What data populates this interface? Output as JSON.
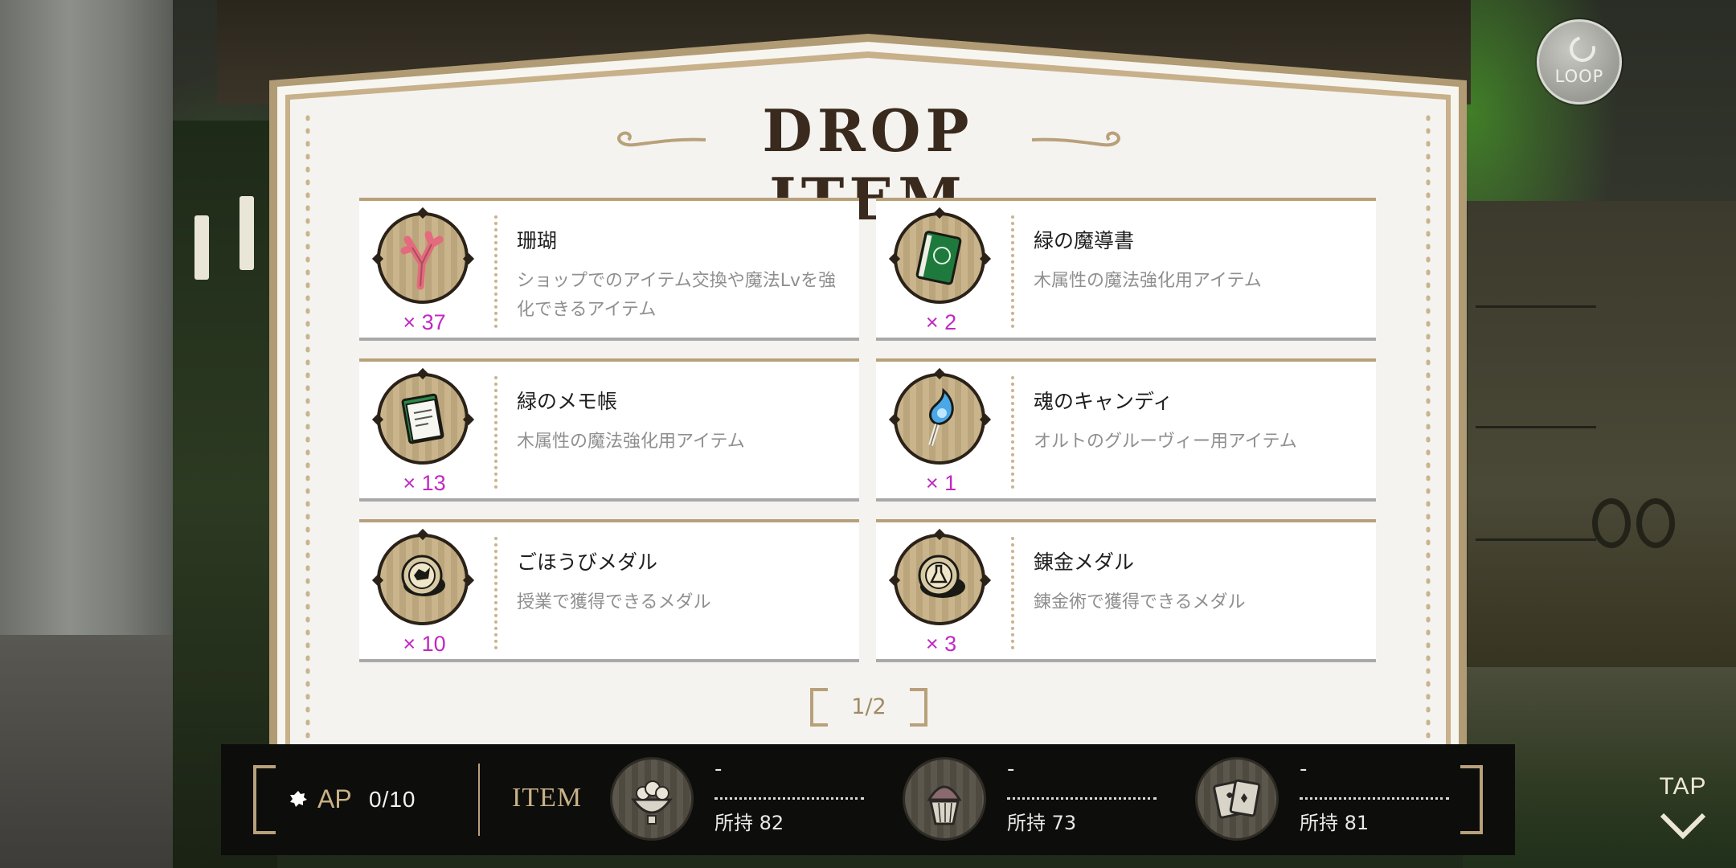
{
  "header": {
    "title": "DROP ITEM",
    "loop_label": "LOOP"
  },
  "items": [
    {
      "name": "珊瑚",
      "description": "ショップでのアイテム交換や魔法Lvを強化できるアイテム",
      "quantity": "× 37",
      "icon": "coral-icon"
    },
    {
      "name": "緑の魔導書",
      "description": "木属性の魔法強化用アイテム",
      "quantity": "× 2",
      "icon": "green-grimoire-icon"
    },
    {
      "name": "緑のメモ帳",
      "description": "木属性の魔法強化用アイテム",
      "quantity": "× 13",
      "icon": "green-notepad-icon"
    },
    {
      "name": "魂のキャンディ",
      "description": "オルトのグルーヴィー用アイテム",
      "quantity": "× 1",
      "icon": "soul-candy-icon"
    },
    {
      "name": "ごほうびメダル",
      "description": "授業で獲得できるメダル",
      "quantity": "× 10",
      "icon": "reward-medal-icon"
    },
    {
      "name": "錬金メダル",
      "description": "錬金術で獲得できるメダル",
      "quantity": "× 3",
      "icon": "alchemy-medal-icon"
    }
  ],
  "pagination": {
    "label": "1/2",
    "current": 1,
    "total": 2
  },
  "bottom_bar": {
    "ap_label": "AP",
    "ap_value": "0/10",
    "item_label": "ITEM",
    "slots": [
      {
        "value": "-",
        "owned": "所持 82",
        "icon": "food-bowl-icon"
      },
      {
        "value": "-",
        "owned": "所持 73",
        "icon": "cupcake-icon"
      },
      {
        "value": "-",
        "owned": "所持 81",
        "icon": "cards-icon"
      }
    ]
  },
  "tap_label": "TAP",
  "colors": {
    "panel_bg": "#f4f3ef",
    "gold_border": "#b8a07a",
    "quantity": "#c128c2",
    "bar_bg": "#0d0d0b"
  }
}
